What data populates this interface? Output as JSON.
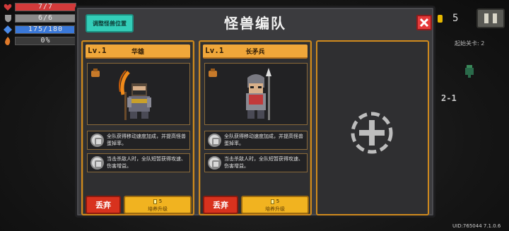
{
  "hud": {
    "hp": {
      "text": "7/7",
      "fill": 1.0,
      "color": "#d23a3a"
    },
    "armor": {
      "text": "6/6",
      "fill": 1.0,
      "color": "#8a8a8a"
    },
    "energy": {
      "text": "175/180",
      "fill": 0.972,
      "color": "#3a78d8"
    },
    "crit": {
      "text": "0%",
      "fill": 0.0,
      "color": "#6a4a2a"
    }
  },
  "right_hud": {
    "coins": "5",
    "level_label": "起始关卡: 2",
    "stage": "2-1",
    "uid": "UID:765044 7.1.0.6"
  },
  "dialog": {
    "title": "怪兽编队",
    "adjust_button": "调整怪兽位置",
    "cards": [
      {
        "level": "Lv.1",
        "name": "华雄",
        "skills": [
          "全队获得移动速度加成，并提高怪兽蛋掉率。",
          "当击杀敌人时，全队短暂获得攻速、伤害增益。"
        ],
        "discard": "丢弃",
        "upgrade_cost": "5",
        "upgrade_label": "培养升级"
      },
      {
        "level": "Lv.1",
        "name": "长矛兵",
        "skills": [
          "全队获得移动速度加成，并提高怪兽蛋掉率。",
          "当击杀敌人时，全队短暂获得攻速、伤害增益。"
        ],
        "discard": "丢弃",
        "upgrade_cost": "5",
        "upgrade_label": "培养升级"
      }
    ]
  }
}
